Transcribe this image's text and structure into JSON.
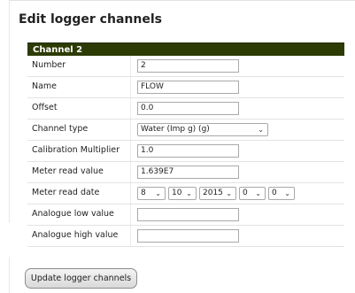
{
  "page": {
    "title": "Edit logger channels"
  },
  "channel": {
    "header": "Channel 2",
    "fields": {
      "number": {
        "label": "Number",
        "value": "2"
      },
      "name": {
        "label": "Name",
        "value": "FLOW"
      },
      "offset": {
        "label": "Offset",
        "value": "0.0"
      },
      "channel_type": {
        "label": "Channel type",
        "value": "Water (Imp g) (g)"
      },
      "calibration_multiplier": {
        "label": "Calibration Multiplier",
        "value": "1.0"
      },
      "meter_read_value": {
        "label": "Meter read value",
        "value": "1.639E7"
      },
      "meter_read_date": {
        "label": "Meter read date",
        "day": "8",
        "month": "10",
        "year": "2015",
        "hour": "0",
        "minute": "0"
      },
      "analogue_low_value": {
        "label": "Analogue low value",
        "value": ""
      },
      "analogue_high_value": {
        "label": "Analogue high value",
        "value": ""
      }
    }
  },
  "actions": {
    "update_label": "Update logger channels"
  },
  "icons": {
    "select_arrow": "chevron-down-icon"
  },
  "colors": {
    "header_bg": "#2d3b04",
    "header_text": "#ffffff"
  }
}
